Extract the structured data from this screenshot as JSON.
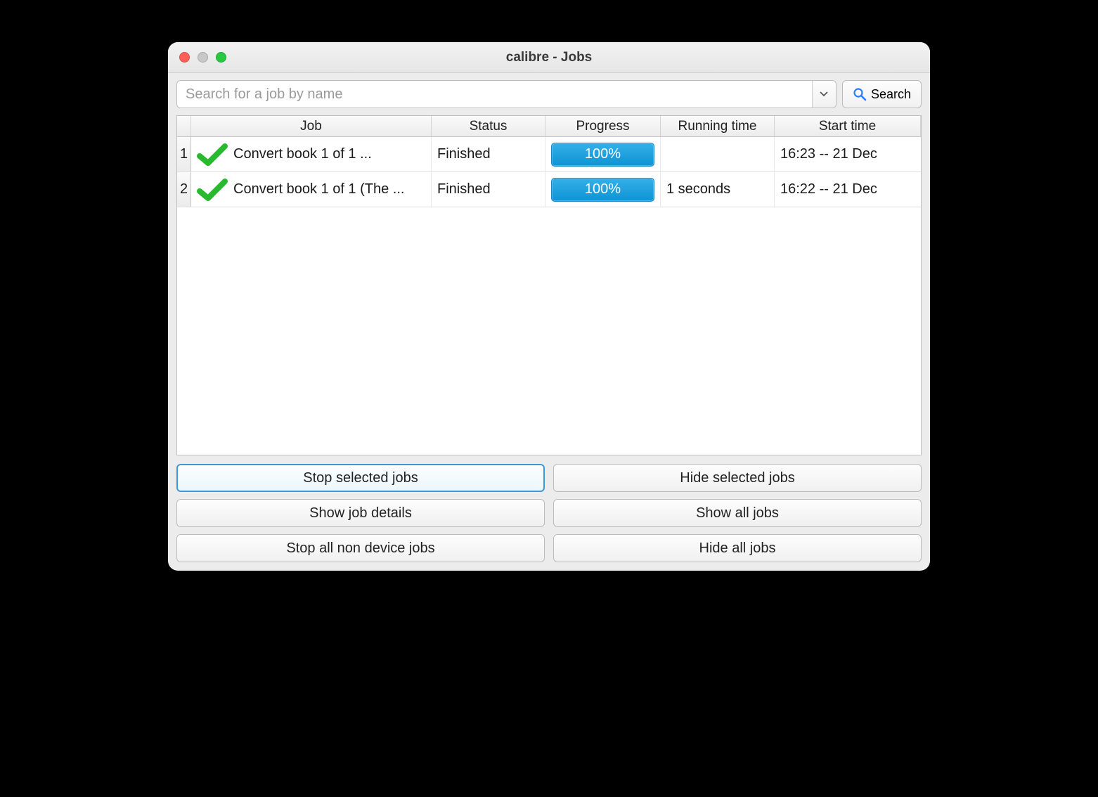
{
  "window": {
    "title": "calibre - Jobs"
  },
  "search": {
    "placeholder": "Search for a job by name",
    "button": "Search"
  },
  "columns": {
    "job": "Job",
    "status": "Status",
    "progress": "Progress",
    "running": "Running time",
    "start": "Start time"
  },
  "jobs": [
    {
      "num": "1",
      "name": "Convert book 1 of 1 ...",
      "status": "Finished",
      "progress": "100%",
      "running": "",
      "start": "16:23 -- 21 Dec"
    },
    {
      "num": "2",
      "name": "Convert book 1 of 1 (The ...",
      "status": "Finished",
      "progress": "100%",
      "running": "1 seconds",
      "start": "16:22 -- 21 Dec"
    }
  ],
  "buttons": {
    "stop_selected": "Stop selected jobs",
    "hide_selected": "Hide selected jobs",
    "show_details": "Show job details",
    "show_all": "Show all jobs",
    "stop_non_device": "Stop all non device jobs",
    "hide_all": "Hide all jobs"
  }
}
